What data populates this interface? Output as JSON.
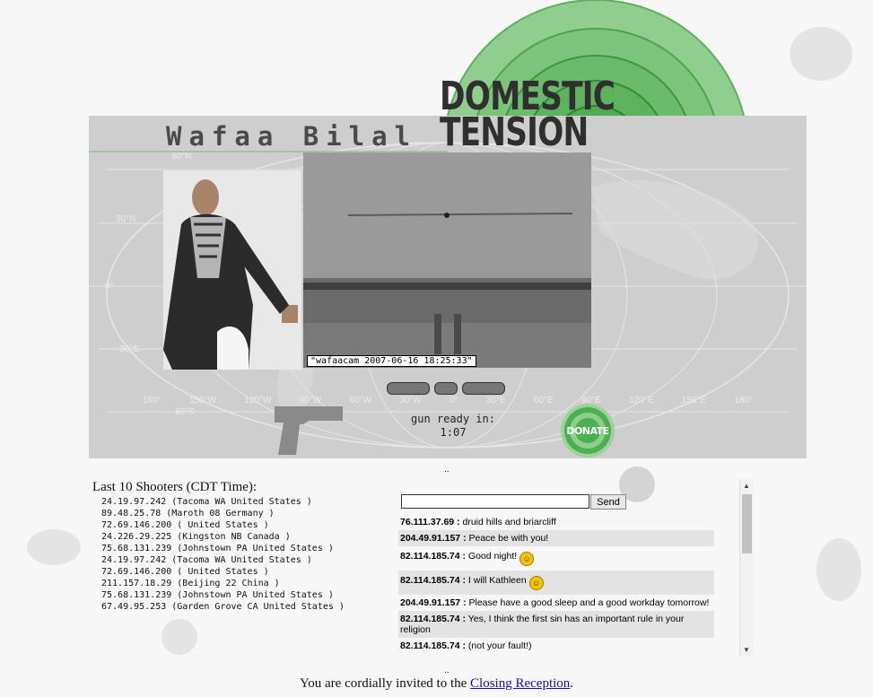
{
  "header": {
    "artist_name": "Wafaa Bilal",
    "project_title_line1": "DOMESTIC",
    "project_title_line2": "TENSION"
  },
  "map_labels": {
    "latitudes": [
      "60°N",
      "30°N",
      "0°",
      "30°S",
      "60°S"
    ],
    "longitudes": [
      "180°",
      "150°W",
      "120°W",
      "90°W",
      "60°W",
      "30°W",
      "0°",
      "30°E",
      "60°E",
      "90°E",
      "120°E",
      "150°E",
      "180°"
    ]
  },
  "cam": {
    "timestamp": "\"wafaacam 2007-06-16 18:25:33\""
  },
  "gun": {
    "ready_label": "gun ready in:",
    "countdown": "1:07"
  },
  "donate_label": "DONATE",
  "shooters": {
    "title": "Last 10 Shooters (CDT Time):",
    "entries": [
      "24.19.97.242 (Tacoma WA United States )",
      "89.48.25.78 (Maroth 08 Germany )",
      "72.69.146.200 ( United States )",
      "24.226.29.225 (Kingston NB Canada )",
      "75.68.131.239 (Johnstown PA United States )",
      "24.19.97.242 (Tacoma WA United States )",
      "72.69.146.200 ( United States )",
      "211.157.18.29 (Beijing 22 China )",
      "75.68.131.239 (Johnstown PA United States )",
      "67.49.95.253 (Garden Grove CA United States )"
    ]
  },
  "chat": {
    "top_dots": "..",
    "bottom_dots": "..",
    "input_value": "",
    "send_label": "Send",
    "messages": [
      {
        "ip": "76.111.37.69 :",
        "text": " druid hills and briarcliff",
        "smiley": false
      },
      {
        "ip": "204.49.91.157 :",
        "text": " Peace be with you!",
        "smiley": false
      },
      {
        "ip": "82.114.185.74 :",
        "text": " Good night! ",
        "smiley": true
      },
      {
        "ip": "82.114.185.74 :",
        "text": " I will Kathleen ",
        "smiley": true
      },
      {
        "ip": "204.49.91.157 :",
        "text": " Please have a good sleep and a good workday tomorrow!",
        "smiley": false
      },
      {
        "ip": "82.114.185.74 :",
        "text": " Yes, I think the first sin has an important rule in your religion",
        "smiley": false
      },
      {
        "ip": "82.114.185.74 :",
        "text": " (not your fault!)",
        "smiley": false
      }
    ]
  },
  "footer": {
    "text_before": "You are cordially invited to the ",
    "link_text": "Closing Reception",
    "text_after": "."
  },
  "colors": {
    "target_green": "#4caf50",
    "panel_grey": "#c9c9c9",
    "link": "#1a0dab"
  }
}
